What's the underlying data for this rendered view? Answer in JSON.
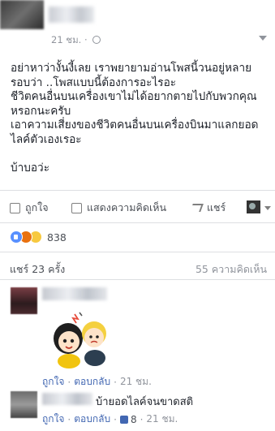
{
  "post": {
    "timestamp": "21 ชม.",
    "body": "อย่าหาว่างั้นงี้เลย เราพยายามอ่านโพสนี้วนอยู่หลายรอบว่า ..โพสแบบนี้ต้องการอะไรอะ\nชีวิตคนอื่นบนเครื่องเขาไม่ได้อยากตายไปกับพวกคุณหรอกนะครับ\nเอาความเสี่ยงของชีวิตคนอื่นบนเครื่องบินมาแลกยอดไลค์ตัวเองเรอะ\n\nบ้าบอว่ะ"
  },
  "actions": {
    "like": "ถูกใจ",
    "comment": "แสดงความคิดเห็น",
    "share": "แชร์"
  },
  "reactions": {
    "count": "838",
    "icons": [
      "like-icon",
      "angry-icon",
      "sad-icon"
    ],
    "colors": {
      "like": "#5890ff",
      "angry": "#e9710f",
      "sad": "#f7c940"
    }
  },
  "stats": {
    "shares": "แชร์ 23 ครั้ง",
    "comments": "55 ความคิดเห็น"
  },
  "comments": [
    {
      "has_sticker": true,
      "like_label": "ถูกใจ",
      "reply_label": "ตอบกลับ",
      "time": "21 ชม."
    },
    {
      "text": "บ้ายอดไลค์จนขาดสติ",
      "like_label": "ถูกใจ",
      "reply_label": "ตอบกลับ",
      "likes": "8",
      "time": "21 ชม."
    }
  ]
}
